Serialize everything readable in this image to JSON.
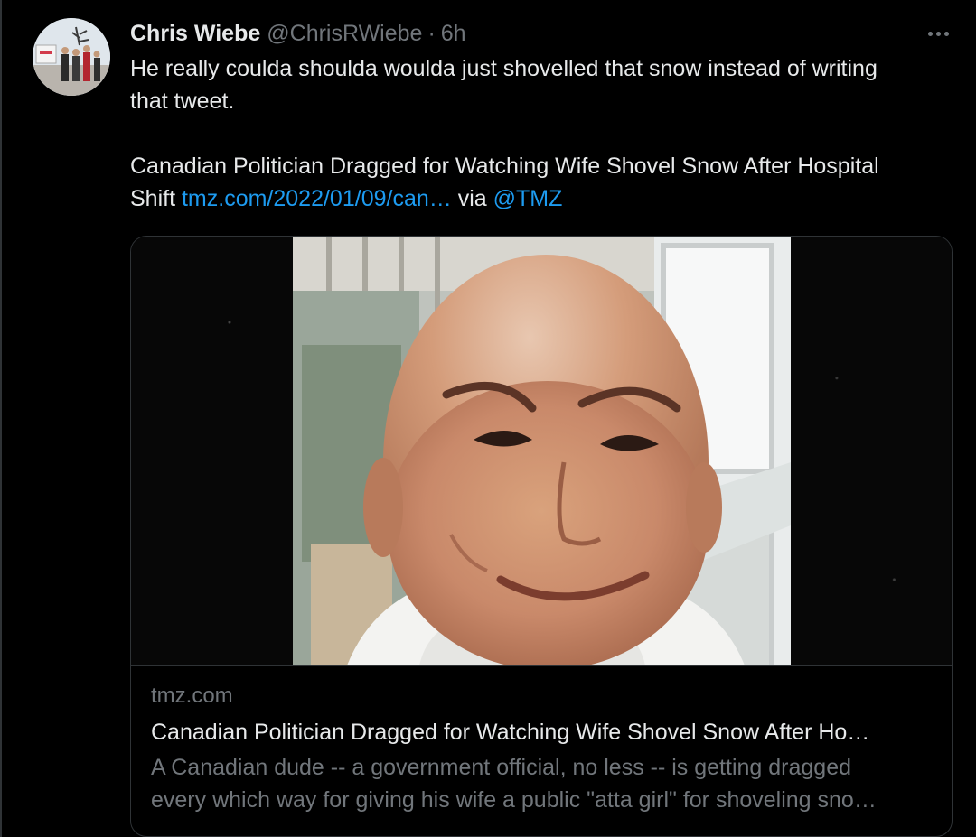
{
  "tweet": {
    "author": {
      "display_name": "Chris Wiebe",
      "handle": "@ChrisRWiebe",
      "separator": "·",
      "time": "6h"
    },
    "text_line1": "He really coulda shoulda woulda just shovelled that snow instead of writing",
    "text_line2": "that tweet.",
    "headline_line1": "Canadian Politician Dragged for Watching Wife Shovel Snow After Hospital",
    "headline_prefix": "Shift ",
    "link_text": "tmz.com/2022/01/09/can…",
    "via_text": " via ",
    "mention": "@TMZ"
  },
  "card": {
    "domain": "tmz.com",
    "title": "Canadian Politician Dragged for Watching Wife Shovel Snow After Ho…",
    "description_line1": "A Canadian dude -- a government official, no less -- is getting dragged",
    "description_line2": "every which way for giving his wife a public \"atta girl\" for shoveling sno…"
  },
  "icons": {
    "more": "more-horizontal-icon"
  },
  "colors": {
    "background": "#000000",
    "text_primary": "#e7e9ea",
    "text_secondary": "#71767b",
    "link": "#1d9bf0",
    "border": "#2f3336"
  }
}
